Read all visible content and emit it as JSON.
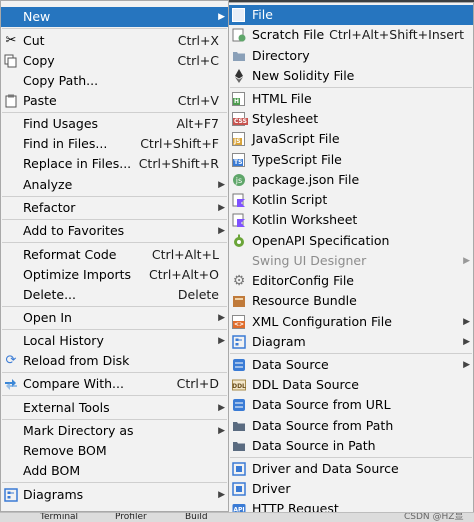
{
  "context_menu": {
    "items": [
      {
        "label": "New",
        "selected": true,
        "arrow": true
      },
      {
        "label": "Cut",
        "shortcut": "Ctrl+X",
        "icon": "scissors-icon"
      },
      {
        "label": "Copy",
        "shortcut": "Ctrl+C",
        "icon": "copy-icon"
      },
      {
        "label": "Copy Path..."
      },
      {
        "label": "Paste",
        "shortcut": "Ctrl+V",
        "icon": "paste-icon"
      },
      {
        "label": "Find Usages",
        "shortcut": "Alt+F7"
      },
      {
        "label": "Find in Files...",
        "shortcut": "Ctrl+Shift+F"
      },
      {
        "label": "Replace in Files...",
        "shortcut": "Ctrl+Shift+R"
      },
      {
        "label": "Analyze",
        "arrow": true
      },
      {
        "label": "Refactor",
        "arrow": true
      },
      {
        "label": "Add to Favorites",
        "arrow": true
      },
      {
        "label": "Reformat Code",
        "shortcut": "Ctrl+Alt+L"
      },
      {
        "label": "Optimize Imports",
        "shortcut": "Ctrl+Alt+O"
      },
      {
        "label": "Delete...",
        "shortcut": "Delete"
      },
      {
        "label": "Open In",
        "arrow": true
      },
      {
        "label": "Local History",
        "arrow": true
      },
      {
        "label": "Reload from Disk",
        "icon": "reload-icon"
      },
      {
        "label": "Compare With...",
        "shortcut": "Ctrl+D",
        "icon": "compare-icon"
      },
      {
        "label": "External Tools",
        "arrow": true
      },
      {
        "label": "Mark Directory as",
        "arrow": true
      },
      {
        "label": "Remove BOM"
      },
      {
        "label": "Add BOM"
      },
      {
        "label": "Diagrams",
        "arrow": true,
        "icon": "diagram-icon"
      }
    ]
  },
  "submenu": {
    "items": [
      {
        "label": "File",
        "selected": true,
        "icon": "file-icon"
      },
      {
        "label": "Scratch File",
        "shortcut": "Ctrl+Alt+Shift+Insert",
        "icon": "scratch-file-icon"
      },
      {
        "label": "Directory",
        "icon": "folder-icon"
      },
      {
        "label": "New Solidity File",
        "icon": "solidity-icon"
      },
      {
        "label": "HTML File",
        "icon": "html-file-icon"
      },
      {
        "label": "Stylesheet",
        "icon": "css-file-icon"
      },
      {
        "label": "JavaScript File",
        "icon": "js-file-icon"
      },
      {
        "label": "TypeScript File",
        "icon": "ts-file-icon"
      },
      {
        "label": "package.json File",
        "icon": "package-json-icon"
      },
      {
        "label": "Kotlin Script",
        "icon": "kotlin-script-icon"
      },
      {
        "label": "Kotlin Worksheet",
        "icon": "kotlin-worksheet-icon"
      },
      {
        "label": "OpenAPI Specification",
        "icon": "openapi-icon"
      },
      {
        "label": "Swing UI Designer",
        "arrow": true,
        "disabled": true
      },
      {
        "label": "EditorConfig File",
        "icon": "gear-icon"
      },
      {
        "label": "Resource Bundle",
        "icon": "resource-bundle-icon"
      },
      {
        "label": "XML Configuration File",
        "arrow": true,
        "icon": "xml-config-icon"
      },
      {
        "label": "Diagram",
        "arrow": true,
        "icon": "diagram-icon"
      },
      {
        "label": "Data Source",
        "arrow": true,
        "icon": "data-source-icon"
      },
      {
        "label": "DDL Data Source",
        "icon": "ddl-icon"
      },
      {
        "label": "Data Source from URL",
        "icon": "data-source-url-icon"
      },
      {
        "label": "Data Source from Path",
        "icon": "data-source-path-icon"
      },
      {
        "label": "Data Source in Path",
        "icon": "data-source-in-path-icon"
      },
      {
        "label": "Driver and Data Source",
        "icon": "driver-data-source-icon"
      },
      {
        "label": "Driver",
        "icon": "driver-icon"
      },
      {
        "label": "HTTP Request",
        "icon": "api-icon"
      }
    ]
  },
  "top_strip_text": "",
  "bottom_bar": {
    "terminal": "Terminal",
    "profiler": "Profiler",
    "build": "Build",
    "watermark": "CSDN @HZ显"
  },
  "colors": {
    "selection": "#2675bf",
    "menu_bg": "#f2f2f2",
    "separator": "#cfcfcf",
    "disabled_text": "#8c8c8c"
  }
}
